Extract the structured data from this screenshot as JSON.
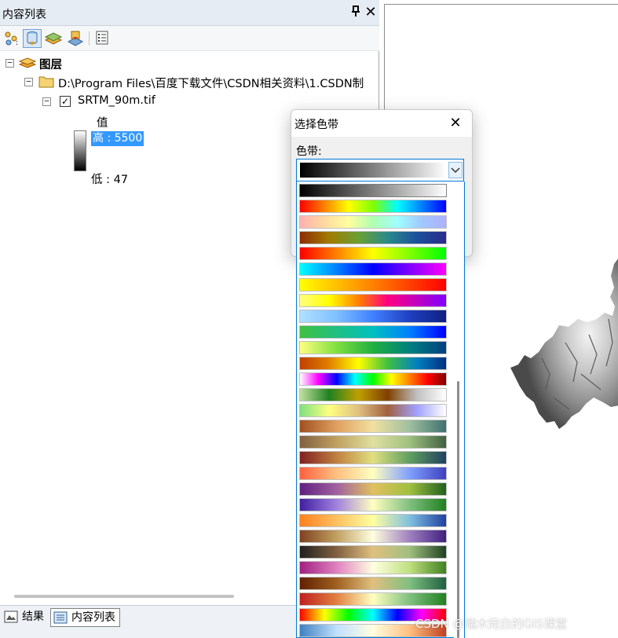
{
  "toc": {
    "title": "内容列表",
    "pin_glyph": "ꟸ",
    "close_glyph": "✕",
    "toolbar_icons": [
      "list-by-drawing-order-icon",
      "list-by-source-icon",
      "list-by-visibility-icon",
      "list-by-selection-icon",
      "options-icon"
    ],
    "tree": {
      "root_label": "图层",
      "folder_label": "D:\\Program Files\\百度下载文件\\CSDN相关资料\\1.CSDN制",
      "layer_label": "SRTM_90m.tif",
      "layer_checked": true,
      "legend_heading": "值",
      "legend_high": "高 : 5500",
      "legend_low": "低 : 47"
    },
    "bottom_tabs": [
      {
        "label": "结果",
        "icon": "results-icon"
      },
      {
        "label": "内容列表",
        "icon": "toc-icon"
      }
    ]
  },
  "dialog": {
    "title": "选择色带",
    "close_glyph": "✕",
    "ramp_label": "色带:",
    "selected_ramp": "linear-gradient(to right,#000000,#ffffff)",
    "ramps": [
      "linear-gradient(to right,#000000,#ffffff)",
      "linear-gradient(to right,#ff0000,#ff8000,#ffff00,#80ff00,#00ffff,#0080ff,#0000ff)",
      "linear-gradient(to right,#ffb0b0,#ffd9a0,#ffffa0,#b0ffb0,#a0ffff,#a0c8ff,#b0b0ff)",
      "linear-gradient(to right,#8c2d04,#a17b00,#6aa034,#2a8a8a,#1c4f9c,#2b2b8c)",
      "linear-gradient(to right,#ff0000,#ff8000,#ffff00,#80ff00,#00ff00)",
      "linear-gradient(to right,#00ffff,#0080ff,#0000ff,#8000ff,#ff00ff)",
      "linear-gradient(to right,#ffff00,#ffc000,#ff8000,#ff4000,#ff0000)",
      "linear-gradient(to right,#ffff80,#ffff00,#ff8000,#ff0080,#c000c0,#8000ff)",
      "linear-gradient(to right,#b0e0ff,#80c0ff,#4080ff,#2040c0,#102080)",
      "linear-gradient(to right,#40c040,#20c080,#00c0c0,#0080ff,#0000ff)",
      "linear-gradient(to right,#ffff80,#80e040,#20b040,#008080,#004080)",
      "linear-gradient(to right,#c04000,#e08000,#ffff00,#40c040,#0080c0,#003080)",
      "linear-gradient(to right,#ffffff,#ff00ff,#0000ff,#00ffff,#00ff00,#ffff00,#ff8000,#ff0000,#800000)",
      "linear-gradient(to right,#c0e0a0,#208020,#c0a000,#804000,#c0c0c0,#ffffff)",
      "linear-gradient(to right,#80e080,#ffff80,#e0c080,#a06040,#a0a0ff,#ffffff)",
      "linear-gradient(to right,#a05020,#e0a060,#f0e0a0,#a0c0a0,#407070)",
      "linear-gradient(to right,#806040,#c0a060,#e0e0a0,#a0c080,#406040)",
      "linear-gradient(to right,#802020,#c08040,#e0e080,#60a060,#204060)",
      "linear-gradient(to right,#ff6040,#ffc080,#ffffc0,#80a0ff,#4040c0)",
      "linear-gradient(to right,#602080,#a060a0,#e0c060,#a0c040,#206020)",
      "linear-gradient(to right,#4020a0,#a080e0,#ffffc0,#80c080,#208020)",
      "linear-gradient(to right,#ff8020,#ffc060,#ffffa0,#80c0e0,#2040a0)",
      "linear-gradient(to right,#804020,#c0a060,#ffffe0,#a080c0,#402080)",
      "linear-gradient(to right,#202020,#806040,#e0c080,#a0c080,#204020)",
      "linear-gradient(to right,#a02080,#e080c0,#ffffe0,#c0e080,#408020)",
      "linear-gradient(to right,#602000,#a06020,#e0c080,#80c080,#206040)",
      "linear-gradient(to right,#c02020,#e08040,#ffffc0,#80c080,#208020)",
      "linear-gradient(to right,#ff0000,#ffff00,#00ff00,#00ffff,#0000ff,#ff00ff,#ff0000)",
      "linear-gradient(to right,#4080c0,#c0e0ff,#ffffe0,#ffc080,#c04020)"
    ]
  },
  "watermark": "CSDN @端木宛白的GIS课堂"
}
